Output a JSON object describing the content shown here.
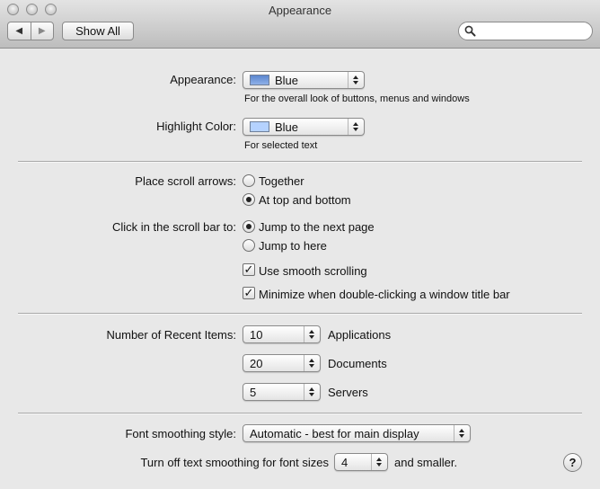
{
  "window": {
    "title": "Appearance"
  },
  "toolbar": {
    "back_glyph": "◀",
    "forward_glyph": "▶",
    "show_all_label": "Show All",
    "search": {
      "value": "",
      "placeholder": ""
    }
  },
  "appearance": {
    "label": "Appearance:",
    "value": "Blue",
    "swatch_color": "#5a86cf",
    "help": "For the overall look of buttons, menus and windows"
  },
  "highlight": {
    "label": "Highlight Color:",
    "value": "Blue",
    "swatch_color": "#b5d2ff",
    "help": "For selected text"
  },
  "scroll_arrows": {
    "label": "Place scroll arrows:",
    "options": [
      {
        "label": "Together",
        "selected": false
      },
      {
        "label": "At top and bottom",
        "selected": true
      }
    ]
  },
  "scroll_click": {
    "label": "Click in the scroll bar to:",
    "options": [
      {
        "label": "Jump to the next page",
        "selected": true
      },
      {
        "label": "Jump to here",
        "selected": false
      }
    ]
  },
  "checkboxes": [
    {
      "label": "Use smooth scrolling",
      "checked": true
    },
    {
      "label": "Minimize when double-clicking a window title bar",
      "checked": true
    }
  ],
  "recent_items": {
    "label": "Number of Recent Items:",
    "rows": [
      {
        "value": "10",
        "unit": "Applications"
      },
      {
        "value": "20",
        "unit": "Documents"
      },
      {
        "value": "5",
        "unit": "Servers"
      }
    ]
  },
  "font_smoothing": {
    "label": "Font smoothing style:",
    "value": "Automatic - best for main display"
  },
  "text_smoothing": {
    "label": "Turn off text smoothing for font sizes",
    "value": "4",
    "suffix": "and smaller."
  },
  "help_button": {
    "glyph": "?"
  },
  "check_glyph": "✓"
}
